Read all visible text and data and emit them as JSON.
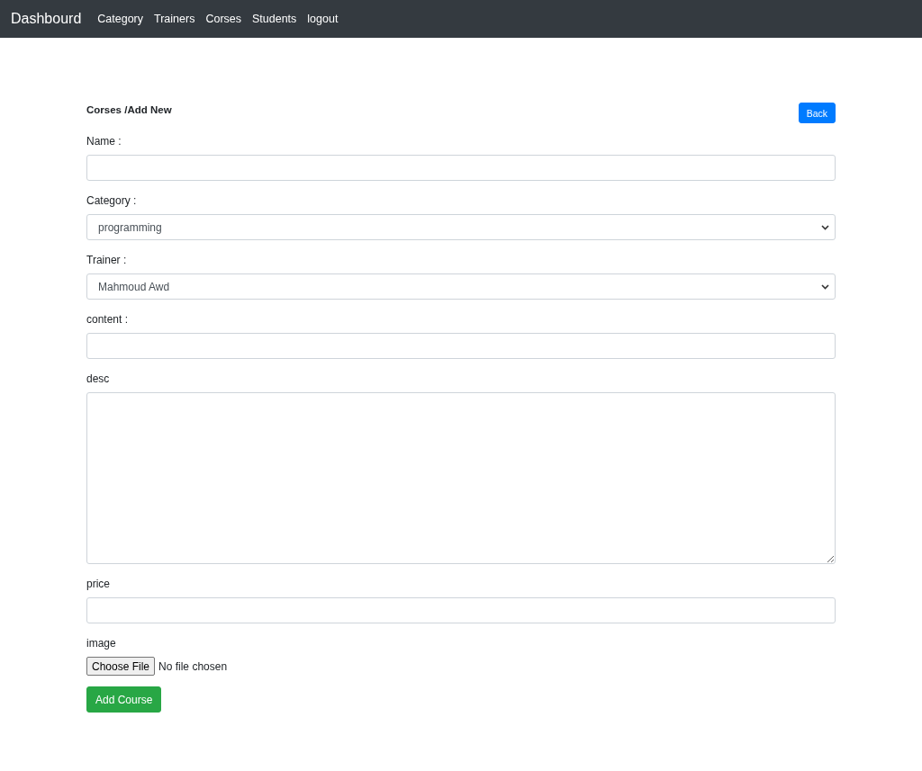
{
  "navbar": {
    "brand": "Dashbourd",
    "links": [
      "Category",
      "Trainers",
      "Corses",
      "Students",
      "logout"
    ]
  },
  "page": {
    "heading": "Corses /Add New",
    "back_button": "Back"
  },
  "fields": [
    {
      "kind": "text",
      "label": "Name :"
    },
    {
      "kind": "select",
      "label": "Category :",
      "value": "programming"
    },
    {
      "kind": "select",
      "label": "Trainer :",
      "value": "Mahmoud Awd"
    },
    {
      "kind": "text",
      "label": "content :"
    },
    {
      "kind": "textarea",
      "label": "desc"
    },
    {
      "kind": "text",
      "label": "price"
    },
    {
      "kind": "file",
      "label": "image",
      "button": "Choose File",
      "status": "No file chosen"
    }
  ],
  "submit_button": "Add Course"
}
